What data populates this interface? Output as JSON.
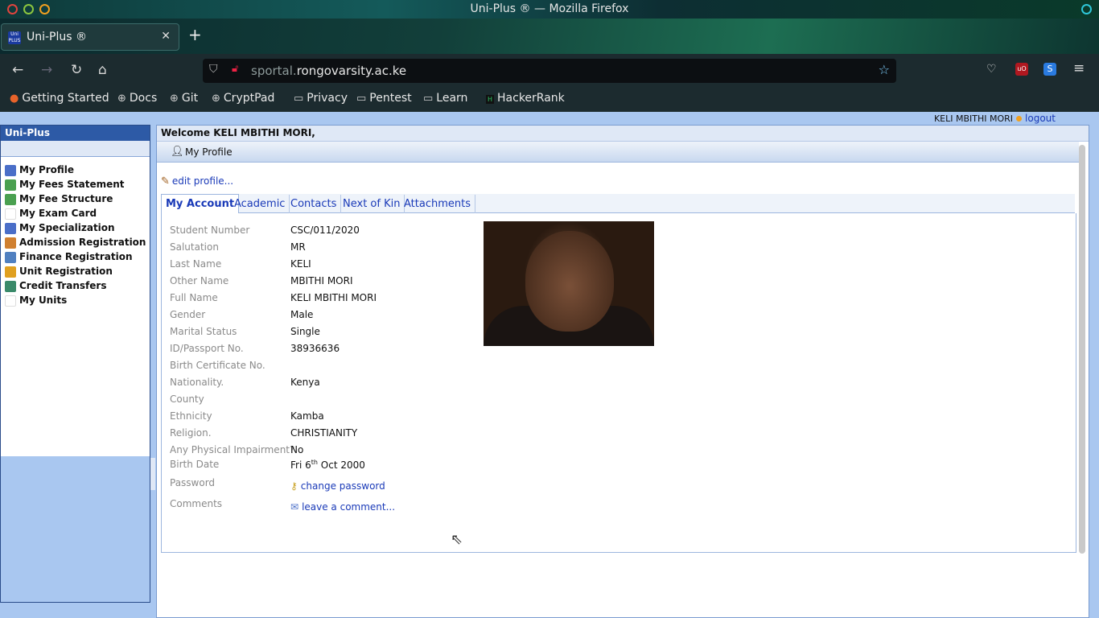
{
  "window": {
    "title": "Uni-Plus ® — Mozilla Firefox"
  },
  "browser": {
    "tab_title": "Uni-Plus ®",
    "tab_favicon_text": "Uni PLUS",
    "url_prefix": "sportal.",
    "url_domain": "rongovarsity.ac.ke",
    "bookmarks": [
      "Getting Started",
      "Docs",
      "Git",
      "CryptPad",
      "Privacy",
      "Pentest",
      "Learn",
      "HackerRank"
    ]
  },
  "header": {
    "user_name": "KELI MBITHI MORI",
    "logout_label": "logout"
  },
  "sidebar": {
    "title": "Uni-Plus",
    "items": [
      {
        "label": "My Profile",
        "icon": "user-icon",
        "color": "#4a6ec8"
      },
      {
        "label": "My Fees Statement",
        "icon": "money-icon",
        "color": "#4aa050"
      },
      {
        "label": "My Fee Structure",
        "icon": "money-icon",
        "color": "#4aa050"
      },
      {
        "label": "My Exam Card",
        "icon": "blank-icon",
        "color": "#ffffff"
      },
      {
        "label": "My Specialization",
        "icon": "user-icon",
        "color": "#4a6ec8"
      },
      {
        "label": "Admission Registration",
        "icon": "form-icon",
        "color": "#d08030"
      },
      {
        "label": "Finance Registration",
        "icon": "form-icon",
        "color": "#5080c0"
      },
      {
        "label": "Unit Registration",
        "icon": "pencil-icon",
        "color": "#e0a020"
      },
      {
        "label": "Credit Transfers",
        "icon": "transfer-icon",
        "color": "#3a8a6a"
      },
      {
        "label": "My Units",
        "icon": "blank-icon",
        "color": "#ffffff"
      }
    ]
  },
  "main": {
    "welcome": "Welcome KELI MBITHI MORI,",
    "section_title": "My Profile",
    "edit_link": "edit profile...",
    "tabs": [
      "My Account",
      "Academic",
      "Contacts",
      "Next of Kin",
      "Attachments"
    ],
    "active_tab": "My Account"
  },
  "profile": {
    "fields": [
      {
        "label": "Student Number",
        "value": "CSC/011/2020"
      },
      {
        "label": "Salutation",
        "value": "MR"
      },
      {
        "label": "Last Name",
        "value": "KELI"
      },
      {
        "label": "Other Name",
        "value": "MBITHI MORI"
      },
      {
        "label": "Full Name",
        "value": "KELI MBITHI MORI"
      },
      {
        "label": "Gender",
        "value": "Male"
      },
      {
        "label": "Marital Status",
        "value": "Single"
      },
      {
        "label": "ID/Passport No.",
        "value": "38936636"
      },
      {
        "label": "Birth Certificate No.",
        "value": ""
      },
      {
        "label": "Nationality.",
        "value": "Kenya"
      },
      {
        "label": "County",
        "value": ""
      },
      {
        "label": "Ethnicity",
        "value": "Kamba"
      },
      {
        "label": "Religion.",
        "value": "CHRISTIANITY"
      },
      {
        "label": "Any Physical Impairment?",
        "value": "No"
      }
    ],
    "birth_date_label": "Birth Date",
    "birth_date_pre": "Fri 6",
    "birth_date_sup": "th",
    "birth_date_post": " Oct 2000",
    "password_label": "Password",
    "password_link": "change password",
    "comments_label": "Comments",
    "comments_link": "leave a comment..."
  }
}
